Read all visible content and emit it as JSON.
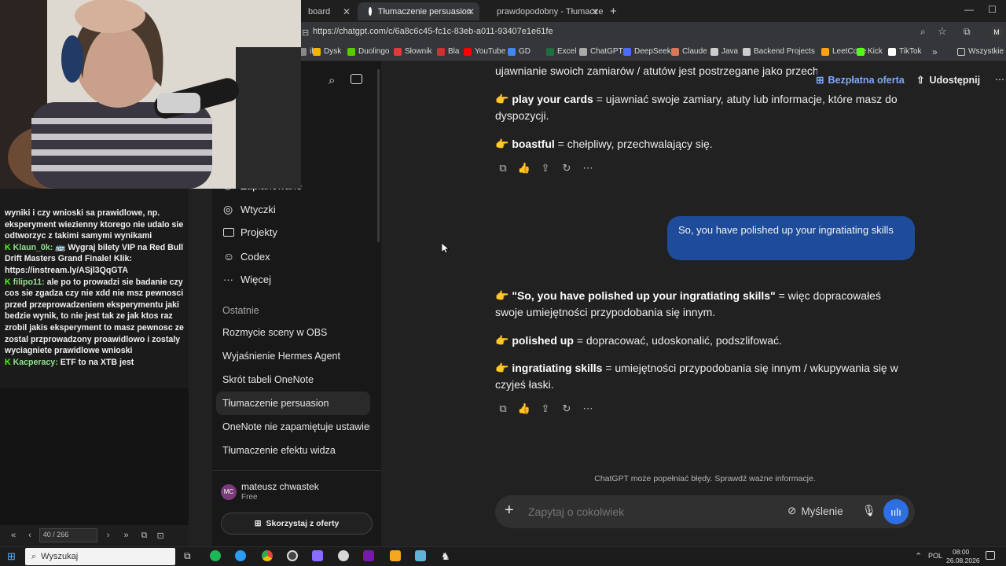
{
  "browser": {
    "tabs": [
      {
        "label": "board",
        "active": false
      },
      {
        "label": "Tłumaczenie persuasion",
        "active": true
      },
      {
        "label": "prawdopodobny - Tłumaczenie",
        "active": false
      }
    ],
    "new_tab": "+",
    "url": "https://chatgpt.com/c/6a8c6c45-fc1c-83eb-a011-93407e1e61fe",
    "bookmarks": [
      {
        "label": "il",
        "color": "#888"
      },
      {
        "label": "Dysk",
        "color": "#f4b400"
      },
      {
        "label": "Duolingo",
        "color": "#58cc02"
      },
      {
        "label": "Słownik",
        "color": "#e53935"
      },
      {
        "label": "Bla",
        "color": "#d32f2f"
      },
      {
        "label": "YouTube",
        "color": "#ff0000"
      },
      {
        "label": "GD",
        "color": "#4285f4"
      },
      {
        "label": "Excel",
        "color": "#1d6f42"
      },
      {
        "label": "ChatGPT",
        "color": "#aaaaaa"
      },
      {
        "label": "DeepSeek",
        "color": "#4d6bfe"
      },
      {
        "label": "Claude",
        "color": "#d97757"
      },
      {
        "label": "Java",
        "color": "#cccccc"
      },
      {
        "label": "Backend Projects",
        "color": "#cccccc"
      },
      {
        "label": "LeetCode",
        "color": "#ffa116"
      },
      {
        "label": "Kick",
        "color": "#53fc18"
      },
      {
        "label": "TikTok",
        "color": "#ffffff"
      }
    ],
    "bookmarks_more": "»",
    "all_bookmarks": "Wszystkie zak"
  },
  "chat_overlay": {
    "partial_top": "wyniki i czy wnioski sa prawidlowe, np. eksperyment wiezienny ktorego nie udalo sie odtworzyc z takimi samymi wynikami",
    "messages": [
      {
        "user": "Klaun_0k:",
        "text": "🚌 Wygraj bilety VIP na Red Bull Drift Masters Grand Finale! Klik: https://instream.ly/ASjl3QqGTA"
      },
      {
        "user": "filipo11:",
        "text": "ale po to prowadzi sie badanie czy cos sie zgadza czy nie xdd nie msz pewnosci przed przeprowadzeniem eksperymentu jaki bedzie wynik, to nie jest tak ze jak ktos raz zrobil jakis eksperyment to masz pewnosc ze zostal przprowadzony proawidlowo i zostaly wyciagniete prawidlowe wnioski"
      },
      {
        "user": "Kacperacy:",
        "text": "ETF to na XTB jest"
      }
    ],
    "pager": "40 / 266"
  },
  "sidebar": {
    "partial_item": "Zaplanowane",
    "nav": [
      {
        "label": "Wtyczki",
        "icon": "plugin-icon"
      },
      {
        "label": "Projekty",
        "icon": "folder-icon"
      },
      {
        "label": "Codex",
        "icon": "codex-icon"
      },
      {
        "label": "Więcej",
        "icon": "more-icon"
      }
    ],
    "recent_heading": "Ostatnie",
    "recent": [
      {
        "label": "Rozmycie sceny w OBS",
        "active": false
      },
      {
        "label": "Wyjaśnienie Hermes Agent",
        "active": false
      },
      {
        "label": "Skrót tabeli OneNote",
        "active": false
      },
      {
        "label": "Tłumaczenie persuasion",
        "active": true
      },
      {
        "label": "OneNote nie zapamiętuje ustawień",
        "active": false
      },
      {
        "label": "Tłumaczenie efektu widza",
        "active": false
      }
    ],
    "user": {
      "initials": "MC",
      "name": "mateusz chwastek",
      "plan": "Free"
    },
    "upgrade": "Skorzystaj z oferty"
  },
  "header": {
    "offer": "Bezpłatna oferta",
    "share": "Udostępnij"
  },
  "conversation": {
    "top_partial": "ujawnianie swoich zamiarów / atutów jest postrzegane jako przechwalanie się.",
    "block1": [
      {
        "term": "play your cards",
        "text": "= ujawniać swoje zamiary, atuty lub informacje, które masz do dyspozycji."
      },
      {
        "term": "boastful",
        "text": "= chełpliwy, przechwalający się."
      }
    ],
    "user_message": "So, you have polished up your ingratiating skills",
    "block2": [
      {
        "term": "\"So, you have polished up your ingratiating skills\"",
        "text": "= więc dopracowałeś swoje umiejętności przypodobania się innym."
      },
      {
        "term": "polished up",
        "text": "= dopracować, udoskonalić, podszlifować."
      },
      {
        "term": "ingratiating skills",
        "text": "= umiejętności przypodobania się innym / wkupywania się w czyjeś łaski."
      }
    ],
    "disclaimer": "ChatGPT może popełniać błędy. Sprawdź ważne informacje.",
    "composer_placeholder": "Zapytaj o cokolwiek",
    "thinking_label": "Myślenie"
  },
  "taskbar": {
    "search": "Wyszukaj",
    "lang": "POL",
    "time": "08:00",
    "date": "26.08.2026"
  }
}
